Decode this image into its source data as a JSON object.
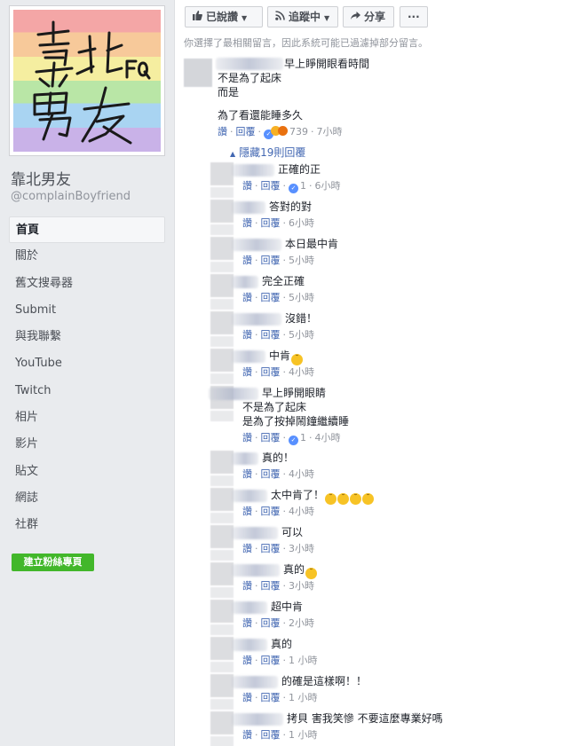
{
  "page": {
    "name": "靠北男友",
    "handle": "@complainBoyfriend",
    "avatar_text": "靠北男友"
  },
  "nav": [
    {
      "label": "首頁",
      "active": true
    },
    {
      "label": "關於"
    },
    {
      "label": "舊文搜尋器"
    },
    {
      "label": "Submit"
    },
    {
      "label": "與我聯繫"
    },
    {
      "label": "YouTube"
    },
    {
      "label": "Twitch"
    },
    {
      "label": "相片"
    },
    {
      "label": "影片"
    },
    {
      "label": "貼文"
    },
    {
      "label": "網誌"
    },
    {
      "label": "社群"
    }
  ],
  "create_page_label": "建立粉絲專頁",
  "actions": {
    "liked_label": "已說讚",
    "follow_label": "追蹤中",
    "share_label": "分享",
    "more_label": "···"
  },
  "notice": "你選擇了最相關留言，因此系統可能已過濾掉部分留言。",
  "main_comment": {
    "lines": [
      "早上睜開眼看時間",
      "不是為了起床",
      "而是",
      "",
      "為了看還能睡多久"
    ],
    "like": "讚",
    "reply": "回覆",
    "reaction_count": "739",
    "time": "7小時"
  },
  "hidden_replies_label": "隱藏19則回覆",
  "replies": [
    {
      "text": "正確的正",
      "like_count": "1",
      "time": "6小時"
    },
    {
      "text": "答對的對",
      "like_count": "",
      "time": "6小時"
    },
    {
      "text": "本日最中肯",
      "like_count": "",
      "time": "5小時"
    },
    {
      "text": "完全正確",
      "like_count": "",
      "time": "5小時"
    },
    {
      "text": "沒錯！",
      "like_count": "",
      "time": "5小時"
    },
    {
      "text": "中肯",
      "emojis": 1,
      "like_count": "",
      "time": "4小時"
    },
    {
      "text": "早上睜開眼睛\n不是為了起床\n是為了按掉鬧鐘繼續睡",
      "like_count": "1",
      "time": "4小時"
    },
    {
      "text": "真的！",
      "like_count": "",
      "time": "4小時"
    },
    {
      "text": "太中肯了！",
      "emojis": 4,
      "like_count": "",
      "time": "4小時"
    },
    {
      "text": "可以",
      "like_count": "",
      "time": "3小時"
    },
    {
      "text": "真的",
      "emojis": 1,
      "like_count": "",
      "time": "3小時"
    },
    {
      "text": "超中肯",
      "like_count": "",
      "time": "2小時"
    },
    {
      "text": "真的",
      "like_count": "",
      "time": "1 小時"
    },
    {
      "text": "的確是這樣啊！！",
      "like_count": "",
      "time": "1 小時"
    },
    {
      "text": "拷貝  害我笑慘  不要這麼專業好嗎",
      "like_count": "",
      "time": "1 小時"
    }
  ],
  "labels": {
    "like": "讚",
    "reply": "回覆"
  },
  "colors": {
    "link": "#4267b2",
    "meta": "#90949c",
    "green": "#42b72a"
  }
}
